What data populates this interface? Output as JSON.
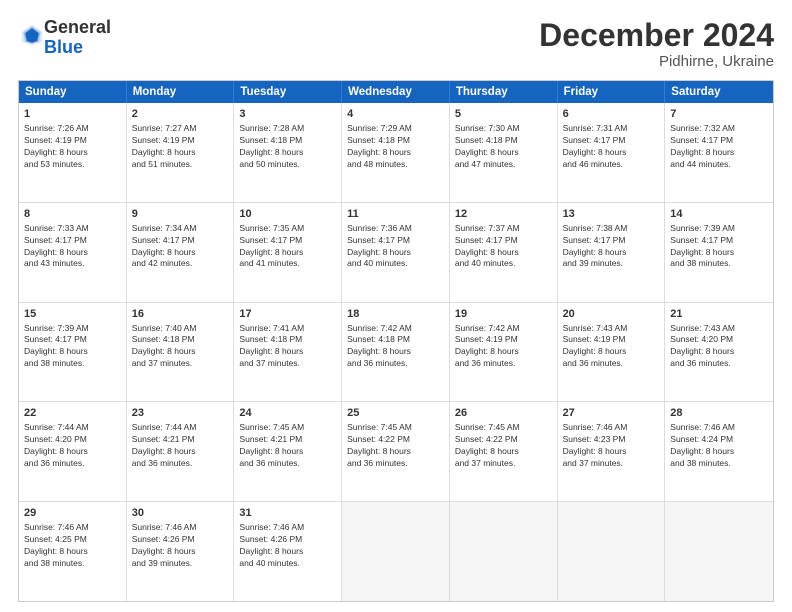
{
  "logo": {
    "general": "General",
    "blue": "Blue"
  },
  "title": "December 2024",
  "subtitle": "Pidhirne, Ukraine",
  "header_days": [
    "Sunday",
    "Monday",
    "Tuesday",
    "Wednesday",
    "Thursday",
    "Friday",
    "Saturday"
  ],
  "weeks": [
    [
      {
        "day": "1",
        "text": "Sunrise: 7:26 AM\nSunset: 4:19 PM\nDaylight: 8 hours\nand 53 minutes."
      },
      {
        "day": "2",
        "text": "Sunrise: 7:27 AM\nSunset: 4:19 PM\nDaylight: 8 hours\nand 51 minutes."
      },
      {
        "day": "3",
        "text": "Sunrise: 7:28 AM\nSunset: 4:18 PM\nDaylight: 8 hours\nand 50 minutes."
      },
      {
        "day": "4",
        "text": "Sunrise: 7:29 AM\nSunset: 4:18 PM\nDaylight: 8 hours\nand 48 minutes."
      },
      {
        "day": "5",
        "text": "Sunrise: 7:30 AM\nSunset: 4:18 PM\nDaylight: 8 hours\nand 47 minutes."
      },
      {
        "day": "6",
        "text": "Sunrise: 7:31 AM\nSunset: 4:17 PM\nDaylight: 8 hours\nand 46 minutes."
      },
      {
        "day": "7",
        "text": "Sunrise: 7:32 AM\nSunset: 4:17 PM\nDaylight: 8 hours\nand 44 minutes."
      }
    ],
    [
      {
        "day": "8",
        "text": "Sunrise: 7:33 AM\nSunset: 4:17 PM\nDaylight: 8 hours\nand 43 minutes."
      },
      {
        "day": "9",
        "text": "Sunrise: 7:34 AM\nSunset: 4:17 PM\nDaylight: 8 hours\nand 42 minutes."
      },
      {
        "day": "10",
        "text": "Sunrise: 7:35 AM\nSunset: 4:17 PM\nDaylight: 8 hours\nand 41 minutes."
      },
      {
        "day": "11",
        "text": "Sunrise: 7:36 AM\nSunset: 4:17 PM\nDaylight: 8 hours\nand 40 minutes."
      },
      {
        "day": "12",
        "text": "Sunrise: 7:37 AM\nSunset: 4:17 PM\nDaylight: 8 hours\nand 40 minutes."
      },
      {
        "day": "13",
        "text": "Sunrise: 7:38 AM\nSunset: 4:17 PM\nDaylight: 8 hours\nand 39 minutes."
      },
      {
        "day": "14",
        "text": "Sunrise: 7:39 AM\nSunset: 4:17 PM\nDaylight: 8 hours\nand 38 minutes."
      }
    ],
    [
      {
        "day": "15",
        "text": "Sunrise: 7:39 AM\nSunset: 4:17 PM\nDaylight: 8 hours\nand 38 minutes."
      },
      {
        "day": "16",
        "text": "Sunrise: 7:40 AM\nSunset: 4:18 PM\nDaylight: 8 hours\nand 37 minutes."
      },
      {
        "day": "17",
        "text": "Sunrise: 7:41 AM\nSunset: 4:18 PM\nDaylight: 8 hours\nand 37 minutes."
      },
      {
        "day": "18",
        "text": "Sunrise: 7:42 AM\nSunset: 4:18 PM\nDaylight: 8 hours\nand 36 minutes."
      },
      {
        "day": "19",
        "text": "Sunrise: 7:42 AM\nSunset: 4:19 PM\nDaylight: 8 hours\nand 36 minutes."
      },
      {
        "day": "20",
        "text": "Sunrise: 7:43 AM\nSunset: 4:19 PM\nDaylight: 8 hours\nand 36 minutes."
      },
      {
        "day": "21",
        "text": "Sunrise: 7:43 AM\nSunset: 4:20 PM\nDaylight: 8 hours\nand 36 minutes."
      }
    ],
    [
      {
        "day": "22",
        "text": "Sunrise: 7:44 AM\nSunset: 4:20 PM\nDaylight: 8 hours\nand 36 minutes."
      },
      {
        "day": "23",
        "text": "Sunrise: 7:44 AM\nSunset: 4:21 PM\nDaylight: 8 hours\nand 36 minutes."
      },
      {
        "day": "24",
        "text": "Sunrise: 7:45 AM\nSunset: 4:21 PM\nDaylight: 8 hours\nand 36 minutes."
      },
      {
        "day": "25",
        "text": "Sunrise: 7:45 AM\nSunset: 4:22 PM\nDaylight: 8 hours\nand 36 minutes."
      },
      {
        "day": "26",
        "text": "Sunrise: 7:45 AM\nSunset: 4:22 PM\nDaylight: 8 hours\nand 37 minutes."
      },
      {
        "day": "27",
        "text": "Sunrise: 7:46 AM\nSunset: 4:23 PM\nDaylight: 8 hours\nand 37 minutes."
      },
      {
        "day": "28",
        "text": "Sunrise: 7:46 AM\nSunset: 4:24 PM\nDaylight: 8 hours\nand 38 minutes."
      }
    ],
    [
      {
        "day": "29",
        "text": "Sunrise: 7:46 AM\nSunset: 4:25 PM\nDaylight: 8 hours\nand 38 minutes."
      },
      {
        "day": "30",
        "text": "Sunrise: 7:46 AM\nSunset: 4:26 PM\nDaylight: 8 hours\nand 39 minutes."
      },
      {
        "day": "31",
        "text": "Sunrise: 7:46 AM\nSunset: 4:26 PM\nDaylight: 8 hours\nand 40 minutes."
      },
      {
        "day": "",
        "text": ""
      },
      {
        "day": "",
        "text": ""
      },
      {
        "day": "",
        "text": ""
      },
      {
        "day": "",
        "text": ""
      }
    ]
  ]
}
